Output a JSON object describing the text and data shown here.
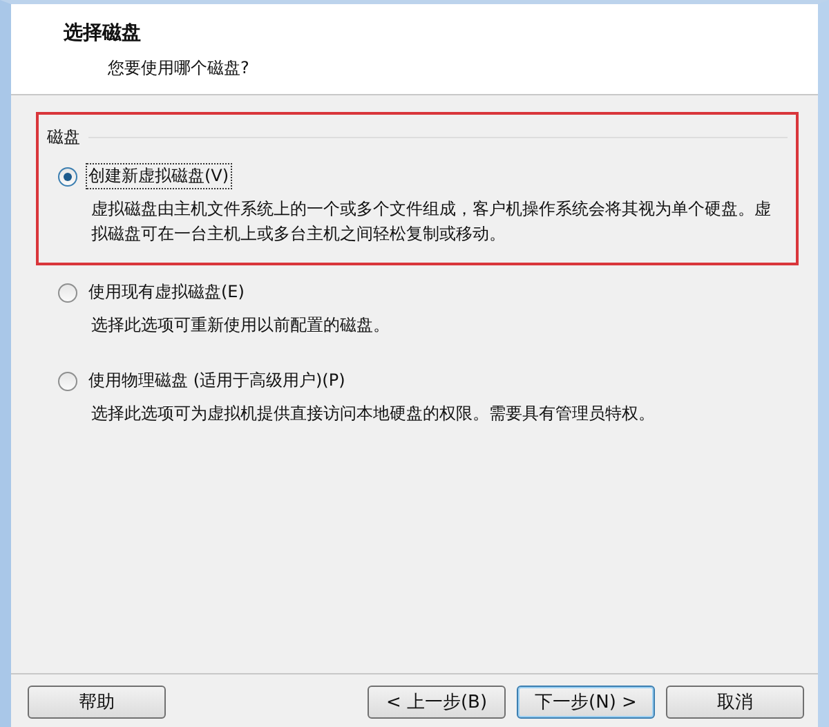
{
  "header": {
    "title": "选择磁盘",
    "subtitle": "您要使用哪个磁盘?"
  },
  "group": {
    "label": "磁盘",
    "highlighted": true
  },
  "options": [
    {
      "label": "创建新虚拟磁盘(V)",
      "selected": true,
      "focused": true,
      "description": "虚拟磁盘由主机文件系统上的一个或多个文件组成，客户机操作系统会将其视为单个硬盘。虚拟磁盘可在一台主机上或多台主机之间轻松复制或移动。"
    },
    {
      "label": "使用现有虚拟磁盘(E)",
      "selected": false,
      "focused": false,
      "description": "选择此选项可重新使用以前配置的磁盘。"
    },
    {
      "label": "使用物理磁盘 (适用于高级用户)(P)",
      "selected": false,
      "focused": false,
      "description": "选择此选项可为虚拟机提供直接访问本地硬盘的权限。需要具有管理员特权。"
    }
  ],
  "buttons": [
    {
      "label": "帮助",
      "kind": "left"
    },
    {
      "label": "< 上一步(B)",
      "kind": "right"
    },
    {
      "label": "下一步(N) >",
      "kind": "default"
    },
    {
      "label": "取消",
      "kind": "right"
    }
  ]
}
